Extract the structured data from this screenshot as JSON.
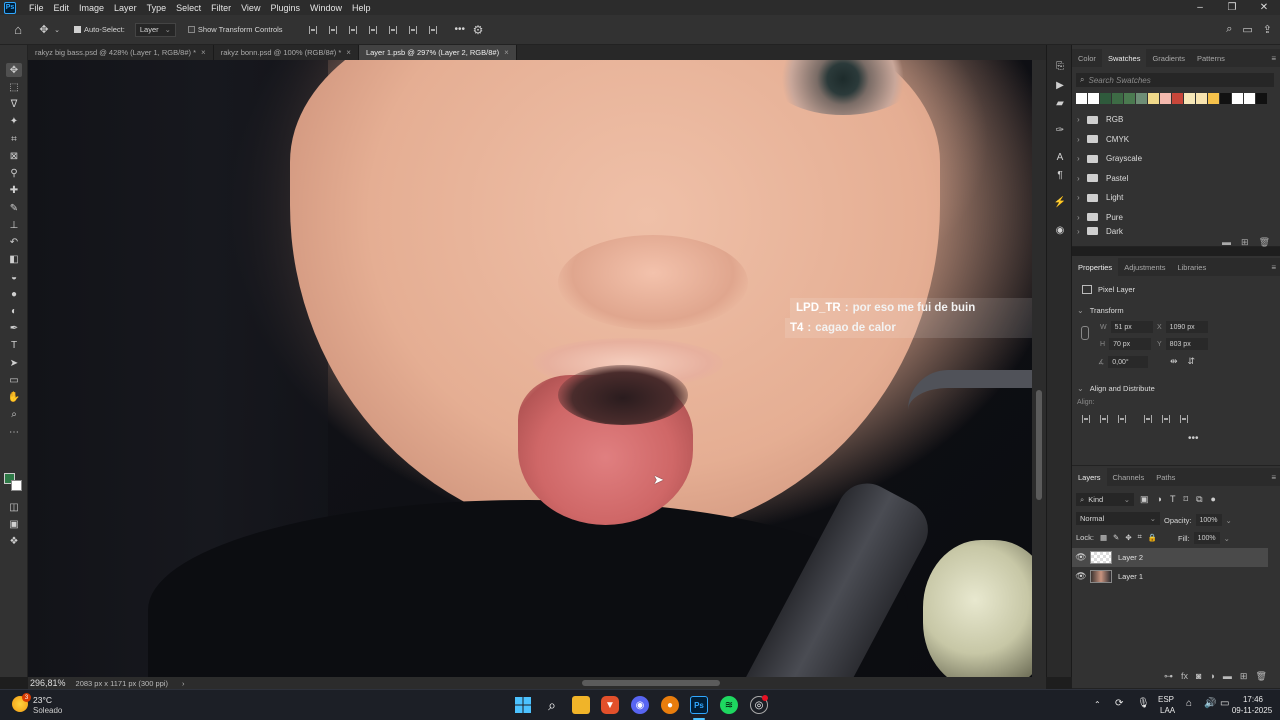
{
  "app": {
    "logo_text": "Ps",
    "menu": [
      "File",
      "Edit",
      "Image",
      "Layer",
      "Type",
      "Select",
      "Filter",
      "View",
      "Plugins",
      "Window",
      "Help"
    ]
  },
  "options_bar": {
    "auto_select_label": "Auto-Select:",
    "auto_select_checked": true,
    "target_value": "Layer",
    "show_transform_label": "Show Transform Controls",
    "show_transform_checked": false,
    "more_label": "•••"
  },
  "tabs": [
    {
      "label": "rakyz big bass.psd @ 428% (Layer 1, RGB/8#) *",
      "active": false
    },
    {
      "label": "rakyz bonn.psd @ 100% (RGB/8#) *",
      "active": false
    },
    {
      "label": "Layer 1.psb @ 297% (Layer 2, RGB/8#)",
      "active": true
    }
  ],
  "chat_overlay": [
    {
      "name": "LPD_TR",
      "message": "por eso me fui de buin"
    },
    {
      "name": "T4",
      "message": "cagao de calor"
    }
  ],
  "status_bar": {
    "zoom": "296,81%",
    "doc_info": "2083 px x 1171 px (300 ppi)",
    "arrow": "›"
  },
  "swatches_panel": {
    "tabs": [
      "Color",
      "Swatches",
      "Gradients",
      "Patterns"
    ],
    "active_tab": "Swatches",
    "search_placeholder": "Search Swatches",
    "recent_colors": [
      "#ffffff",
      "#ffffff",
      "#2f5a3c",
      "#3d6b45",
      "#4b7a50",
      "#6e8e76",
      "#f0d98a",
      "#f4b9ae",
      "#c8463a",
      "#f6e7b8",
      "#f8e4b0",
      "#f6c24b",
      "#111111",
      "#ffffff",
      "#ffffff",
      "#111111"
    ],
    "folders": [
      "RGB",
      "CMYK",
      "Grayscale",
      "Pastel",
      "Light",
      "Pure",
      "Dark"
    ]
  },
  "properties_panel": {
    "tabs": [
      "Properties",
      "Adjustments",
      "Libraries"
    ],
    "active_tab": "Properties",
    "layer_type": "Pixel Layer",
    "transform_label": "Transform",
    "w_label": "W",
    "w_value": "51 px",
    "x_label": "X",
    "x_value": "1090 px",
    "h_label": "H",
    "h_value": "70 px",
    "y_label": "Y",
    "y_value": "803 px",
    "angle_value": "0,00°",
    "align_section": "Align and Distribute",
    "align_label": "Align:",
    "more_label": "•••"
  },
  "layers_panel": {
    "tabs": [
      "Layers",
      "Channels",
      "Paths"
    ],
    "active_tab": "Layers",
    "filter_label": "Kind",
    "blend_mode": "Normal",
    "opacity_label": "Opacity:",
    "opacity_value": "100%",
    "lock_label": "Lock:",
    "fill_label": "Fill:",
    "fill_value": "100%",
    "layers": [
      {
        "name": "Layer 2",
        "selected": true
      },
      {
        "name": "Layer 1",
        "selected": false
      }
    ]
  },
  "taskbar": {
    "weather_temp": "23°C",
    "weather_desc": "Soleado",
    "weather_badge": "3",
    "lang_top": "ESP",
    "lang_bottom": "LAA",
    "time": "17:46",
    "date": "09-11-2025"
  }
}
